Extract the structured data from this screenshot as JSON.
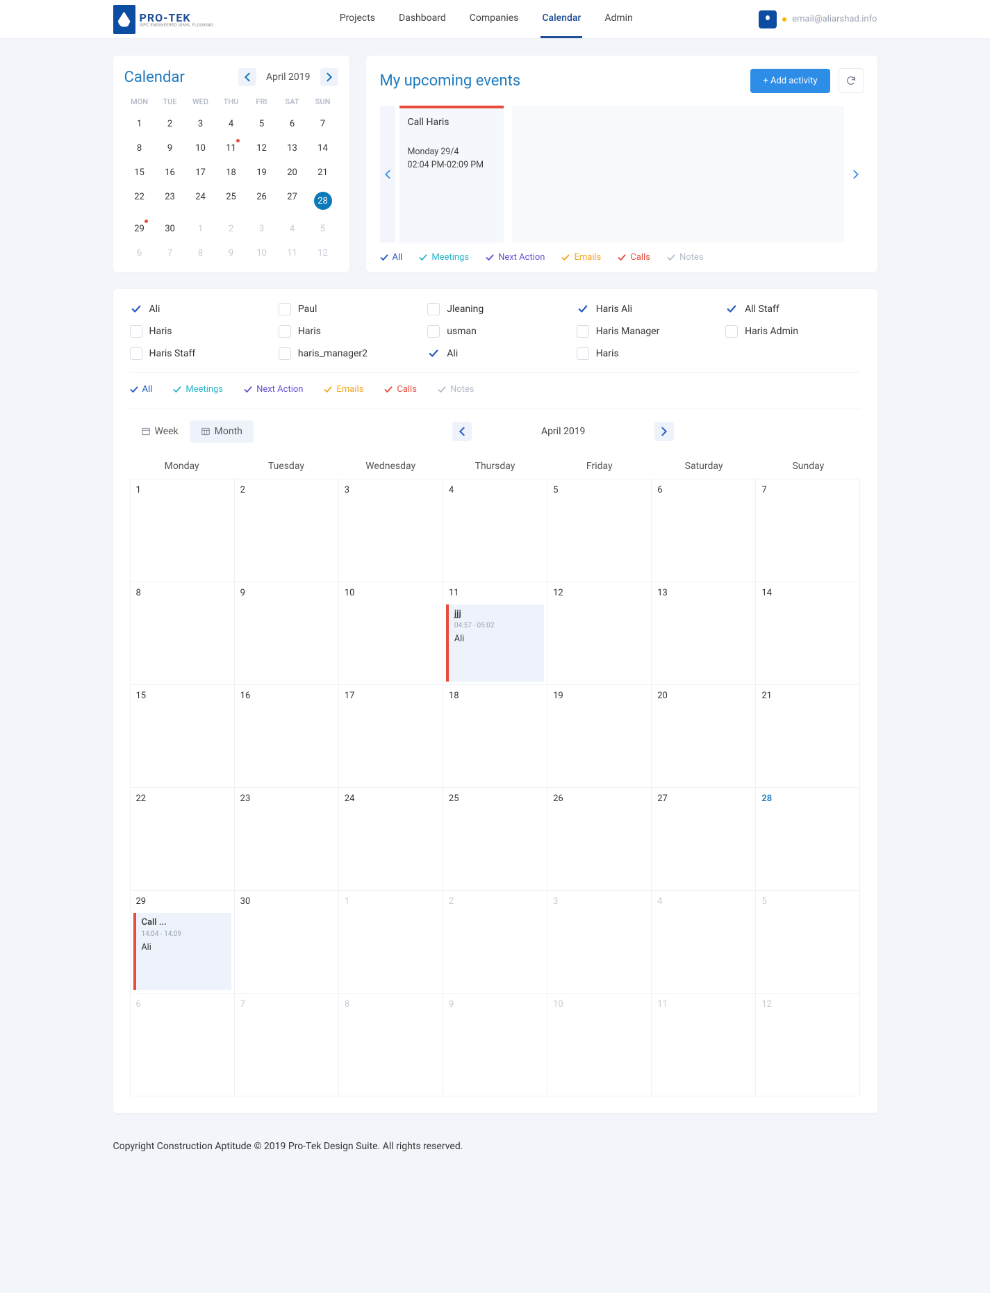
{
  "brand": {
    "name": "PRO-TEK",
    "tagline": "ISPC ENGINEERED VINYL FLOORING"
  },
  "nav": {
    "items": [
      "Projects",
      "Dashboard",
      "Companies",
      "Calendar",
      "Admin"
    ],
    "active": 3
  },
  "user": {
    "email": "email@aliarshad.info"
  },
  "miniCalendar": {
    "title": "Calendar",
    "month": "April 2019",
    "dow": [
      "MON",
      "TUE",
      "WED",
      "THU",
      "FRI",
      "SAT",
      "SUN"
    ],
    "weeks": [
      [
        {
          "n": "1"
        },
        {
          "n": "2"
        },
        {
          "n": "3"
        },
        {
          "n": "4"
        },
        {
          "n": "5"
        },
        {
          "n": "6"
        },
        {
          "n": "7"
        }
      ],
      [
        {
          "n": "8"
        },
        {
          "n": "9"
        },
        {
          "n": "10"
        },
        {
          "n": "11",
          "dot": true
        },
        {
          "n": "12"
        },
        {
          "n": "13"
        },
        {
          "n": "14"
        }
      ],
      [
        {
          "n": "15"
        },
        {
          "n": "16"
        },
        {
          "n": "17"
        },
        {
          "n": "18"
        },
        {
          "n": "19"
        },
        {
          "n": "20"
        },
        {
          "n": "21"
        }
      ],
      [
        {
          "n": "22"
        },
        {
          "n": "23"
        },
        {
          "n": "24"
        },
        {
          "n": "25"
        },
        {
          "n": "26"
        },
        {
          "n": "27"
        },
        {
          "n": "28",
          "sel": true
        }
      ],
      [
        {
          "n": "29",
          "dot": true
        },
        {
          "n": "30"
        },
        {
          "n": "1",
          "o": true
        },
        {
          "n": "2",
          "o": true
        },
        {
          "n": "3",
          "o": true
        },
        {
          "n": "4",
          "o": true
        },
        {
          "n": "5",
          "o": true
        }
      ],
      [
        {
          "n": "6",
          "o": true
        },
        {
          "n": "7",
          "o": true
        },
        {
          "n": "8",
          "o": true
        },
        {
          "n": "9",
          "o": true
        },
        {
          "n": "10",
          "o": true
        },
        {
          "n": "11",
          "o": true
        },
        {
          "n": "12",
          "o": true
        }
      ]
    ]
  },
  "events": {
    "title": "My upcoming events",
    "addLabel": "+ Add activity",
    "card": {
      "title": "Call Haris",
      "date": "Monday 29/4",
      "time": "02:04 PM-02:09 PM"
    },
    "filters": [
      {
        "label": "All",
        "cls": "c-blue"
      },
      {
        "label": "Meetings",
        "cls": "c-cyan"
      },
      {
        "label": "Next Action",
        "cls": "c-purple"
      },
      {
        "label": "Emails",
        "cls": "c-orange"
      },
      {
        "label": "Calls",
        "cls": "c-red"
      },
      {
        "label": "Notes",
        "cls": "c-gray"
      }
    ]
  },
  "people": [
    {
      "name": "Ali",
      "checked": true
    },
    {
      "name": "Paul"
    },
    {
      "name": "Jleaning"
    },
    {
      "name": "Haris Ali",
      "checked": true
    },
    {
      "name": "All Staff",
      "checked": true
    },
    {
      "name": "Haris"
    },
    {
      "name": "Haris"
    },
    {
      "name": "usman"
    },
    {
      "name": "Haris Manager"
    },
    {
      "name": "Haris Admin"
    },
    {
      "name": "Haris Staff"
    },
    {
      "name": "haris_manager2"
    },
    {
      "name": "Ali",
      "checked": true
    },
    {
      "name": "Haris"
    }
  ],
  "typeFilters": [
    {
      "label": "All",
      "cls": "c-blue"
    },
    {
      "label": "Meetings",
      "cls": "c-cyan"
    },
    {
      "label": "Next Action",
      "cls": "c-purple"
    },
    {
      "label": "Emails",
      "cls": "c-orange"
    },
    {
      "label": "Calls",
      "cls": "c-red"
    },
    {
      "label": "Notes",
      "cls": "c-gray"
    }
  ],
  "view": {
    "week": "Week",
    "month": "Month",
    "active": "month",
    "label": "April 2019"
  },
  "bigCalendar": {
    "dow": [
      "Monday",
      "Tuesday",
      "Wednesday",
      "Thursday",
      "Friday",
      "Saturday",
      "Sunday"
    ],
    "cells": [
      {
        "n": "1"
      },
      {
        "n": "2"
      },
      {
        "n": "3"
      },
      {
        "n": "4"
      },
      {
        "n": "5"
      },
      {
        "n": "6"
      },
      {
        "n": "7"
      },
      {
        "n": "8"
      },
      {
        "n": "9"
      },
      {
        "n": "10"
      },
      {
        "n": "11",
        "ev": {
          "title": "jjj",
          "time": "04:57 - 05:02",
          "user": "Ali"
        }
      },
      {
        "n": "12"
      },
      {
        "n": "13"
      },
      {
        "n": "14"
      },
      {
        "n": "15"
      },
      {
        "n": "16"
      },
      {
        "n": "17"
      },
      {
        "n": "18"
      },
      {
        "n": "19"
      },
      {
        "n": "20"
      },
      {
        "n": "21"
      },
      {
        "n": "22"
      },
      {
        "n": "23"
      },
      {
        "n": "24"
      },
      {
        "n": "25"
      },
      {
        "n": "26"
      },
      {
        "n": "27"
      },
      {
        "n": "28",
        "today": true
      },
      {
        "n": "29",
        "ev": {
          "title": "Call ...",
          "time": "14:04 - 14:09",
          "user": "Ali"
        }
      },
      {
        "n": "30"
      },
      {
        "n": "1",
        "o": true
      },
      {
        "n": "2",
        "o": true
      },
      {
        "n": "3",
        "o": true
      },
      {
        "n": "4",
        "o": true
      },
      {
        "n": "5",
        "o": true
      },
      {
        "n": "6",
        "o": true
      },
      {
        "n": "7",
        "o": true
      },
      {
        "n": "8",
        "o": true
      },
      {
        "n": "9",
        "o": true
      },
      {
        "n": "10",
        "o": true
      },
      {
        "n": "11",
        "o": true
      },
      {
        "n": "12",
        "o": true
      }
    ]
  },
  "footer": "Copyright Construction Aptitude © 2019 Pro-Tek Design Suite. All rights reserved."
}
